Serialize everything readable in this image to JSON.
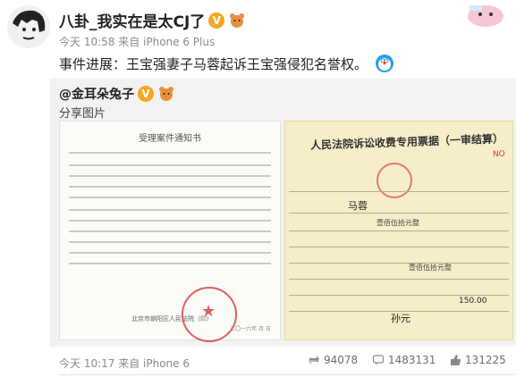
{
  "user": {
    "name": "八卦_我实在是太CJ了",
    "verified": "V",
    "meta": "今天 10:58 来自 iPhone 6 Plus"
  },
  "post": {
    "text": "事件进展：王宝强妻子马蓉起诉王宝强侵犯名誉权。"
  },
  "repost": {
    "user": "@金耳朵兔子",
    "verified": "V",
    "share_label": "分享图片",
    "image1": {
      "title": "受理案件通知书",
      "footer": "北京市朝阳区人民法院（印）",
      "note": "二〇一六年 月 日"
    },
    "image2": {
      "title": "人民法院诉讼收费专用票据（一审结算）",
      "serial": "NO",
      "name1": "马蓉",
      "amount_label": "壹佰伍拾元整",
      "amount_label2": "壹佰伍拾元整",
      "total": "150.00",
      "name2": "孙元"
    }
  },
  "footer": {
    "time": "今天 10:17 来自 iPhone 6",
    "reposts": "94078",
    "comments": "1483131",
    "likes": "131225"
  },
  "icons": {
    "verified_badge": "verified-badge-icon",
    "bear_badge": "bear-badge-icon",
    "repost": "repost-icon",
    "comment": "comment-icon",
    "like": "like-icon"
  },
  "colors": {
    "verified": "#f5a623",
    "link": "#2a6bb7",
    "repost_bg": "#f2f2f2"
  }
}
